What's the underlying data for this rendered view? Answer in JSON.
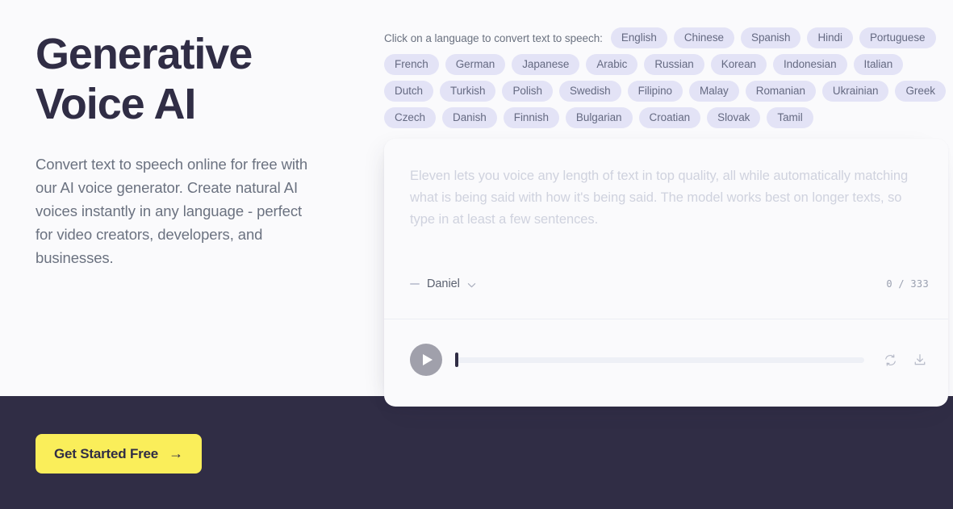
{
  "hero": {
    "title": "Generative Voice AI",
    "subtitle": "Convert text to speech online for free with our AI voice generator. Create natural AI voices instantly in any language - perfect for video creators, developers, and businesses."
  },
  "cta": {
    "label": "Get Started Free",
    "arrow": "→",
    "background": "#faee5a",
    "text_color": "#302d45"
  },
  "languages": {
    "intro": "Click on a language to convert text to speech:",
    "chip_background": "#e3e3f6",
    "chip_text_color": "#656a82",
    "items": [
      "English",
      "Chinese",
      "Spanish",
      "Hindi",
      "Portuguese",
      "French",
      "German",
      "Japanese",
      "Arabic",
      "Russian",
      "Korean",
      "Indonesian",
      "Italian",
      "Dutch",
      "Turkish",
      "Polish",
      "Swedish",
      "Filipino",
      "Malay",
      "Romanian",
      "Ukrainian",
      "Greek",
      "Czech",
      "Danish",
      "Finnish",
      "Bulgarian",
      "Croatian",
      "Slovak",
      "Tamil"
    ]
  },
  "tts": {
    "placeholder": "Eleven lets you voice any length of text in top quality, all while automatically matching what is being said with how it's being said. The model works best on longer texts, so type in at least a few sentences.",
    "value": "",
    "voice_name": "Daniel",
    "char_count": "0 / 333",
    "icons": {
      "chevron": "chevron-down-icon",
      "play": "play-icon",
      "regenerate": "regenerate-icon",
      "download": "download-icon"
    }
  },
  "theme": {
    "page_background": "#fafafc",
    "dark_band": "#302d45",
    "heading_color": "#302d45",
    "body_text_color": "#6b7280"
  }
}
